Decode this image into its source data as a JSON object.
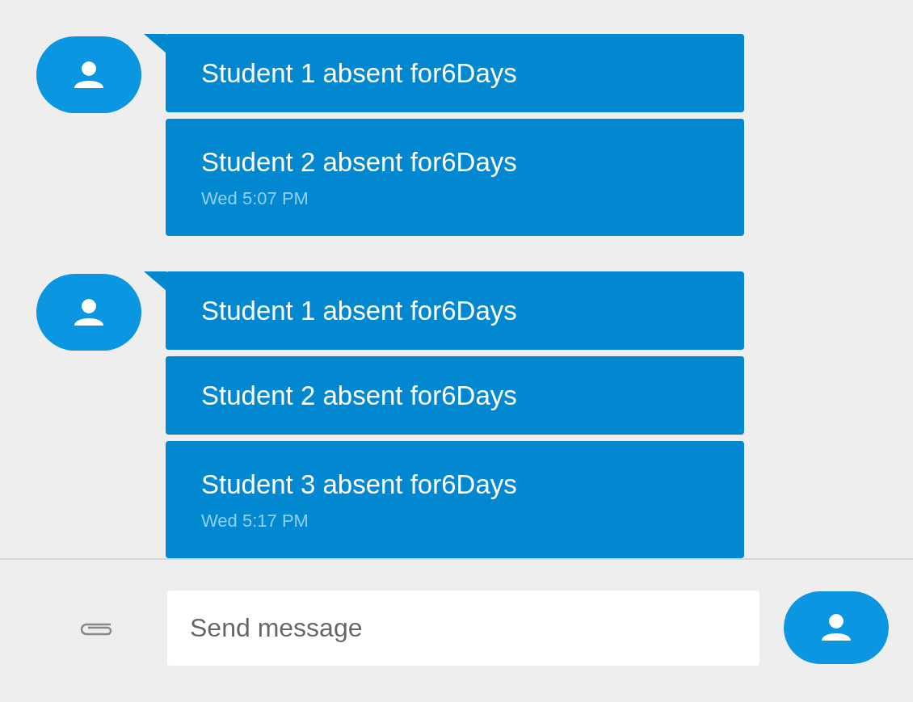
{
  "conversation": [
    {
      "messages": [
        {
          "text": "Student 1 absent for6Days"
        },
        {
          "text": "Student 2 absent for6Days",
          "time": "Wed 5:07 PM"
        }
      ]
    },
    {
      "messages": [
        {
          "text": "Student 1 absent for6Days"
        },
        {
          "text": "Student 2 absent for6Days"
        },
        {
          "text": "Student 3 absent for6Days",
          "time": "Wed 5:17 PM"
        }
      ]
    }
  ],
  "composer": {
    "placeholder": "Send message"
  }
}
